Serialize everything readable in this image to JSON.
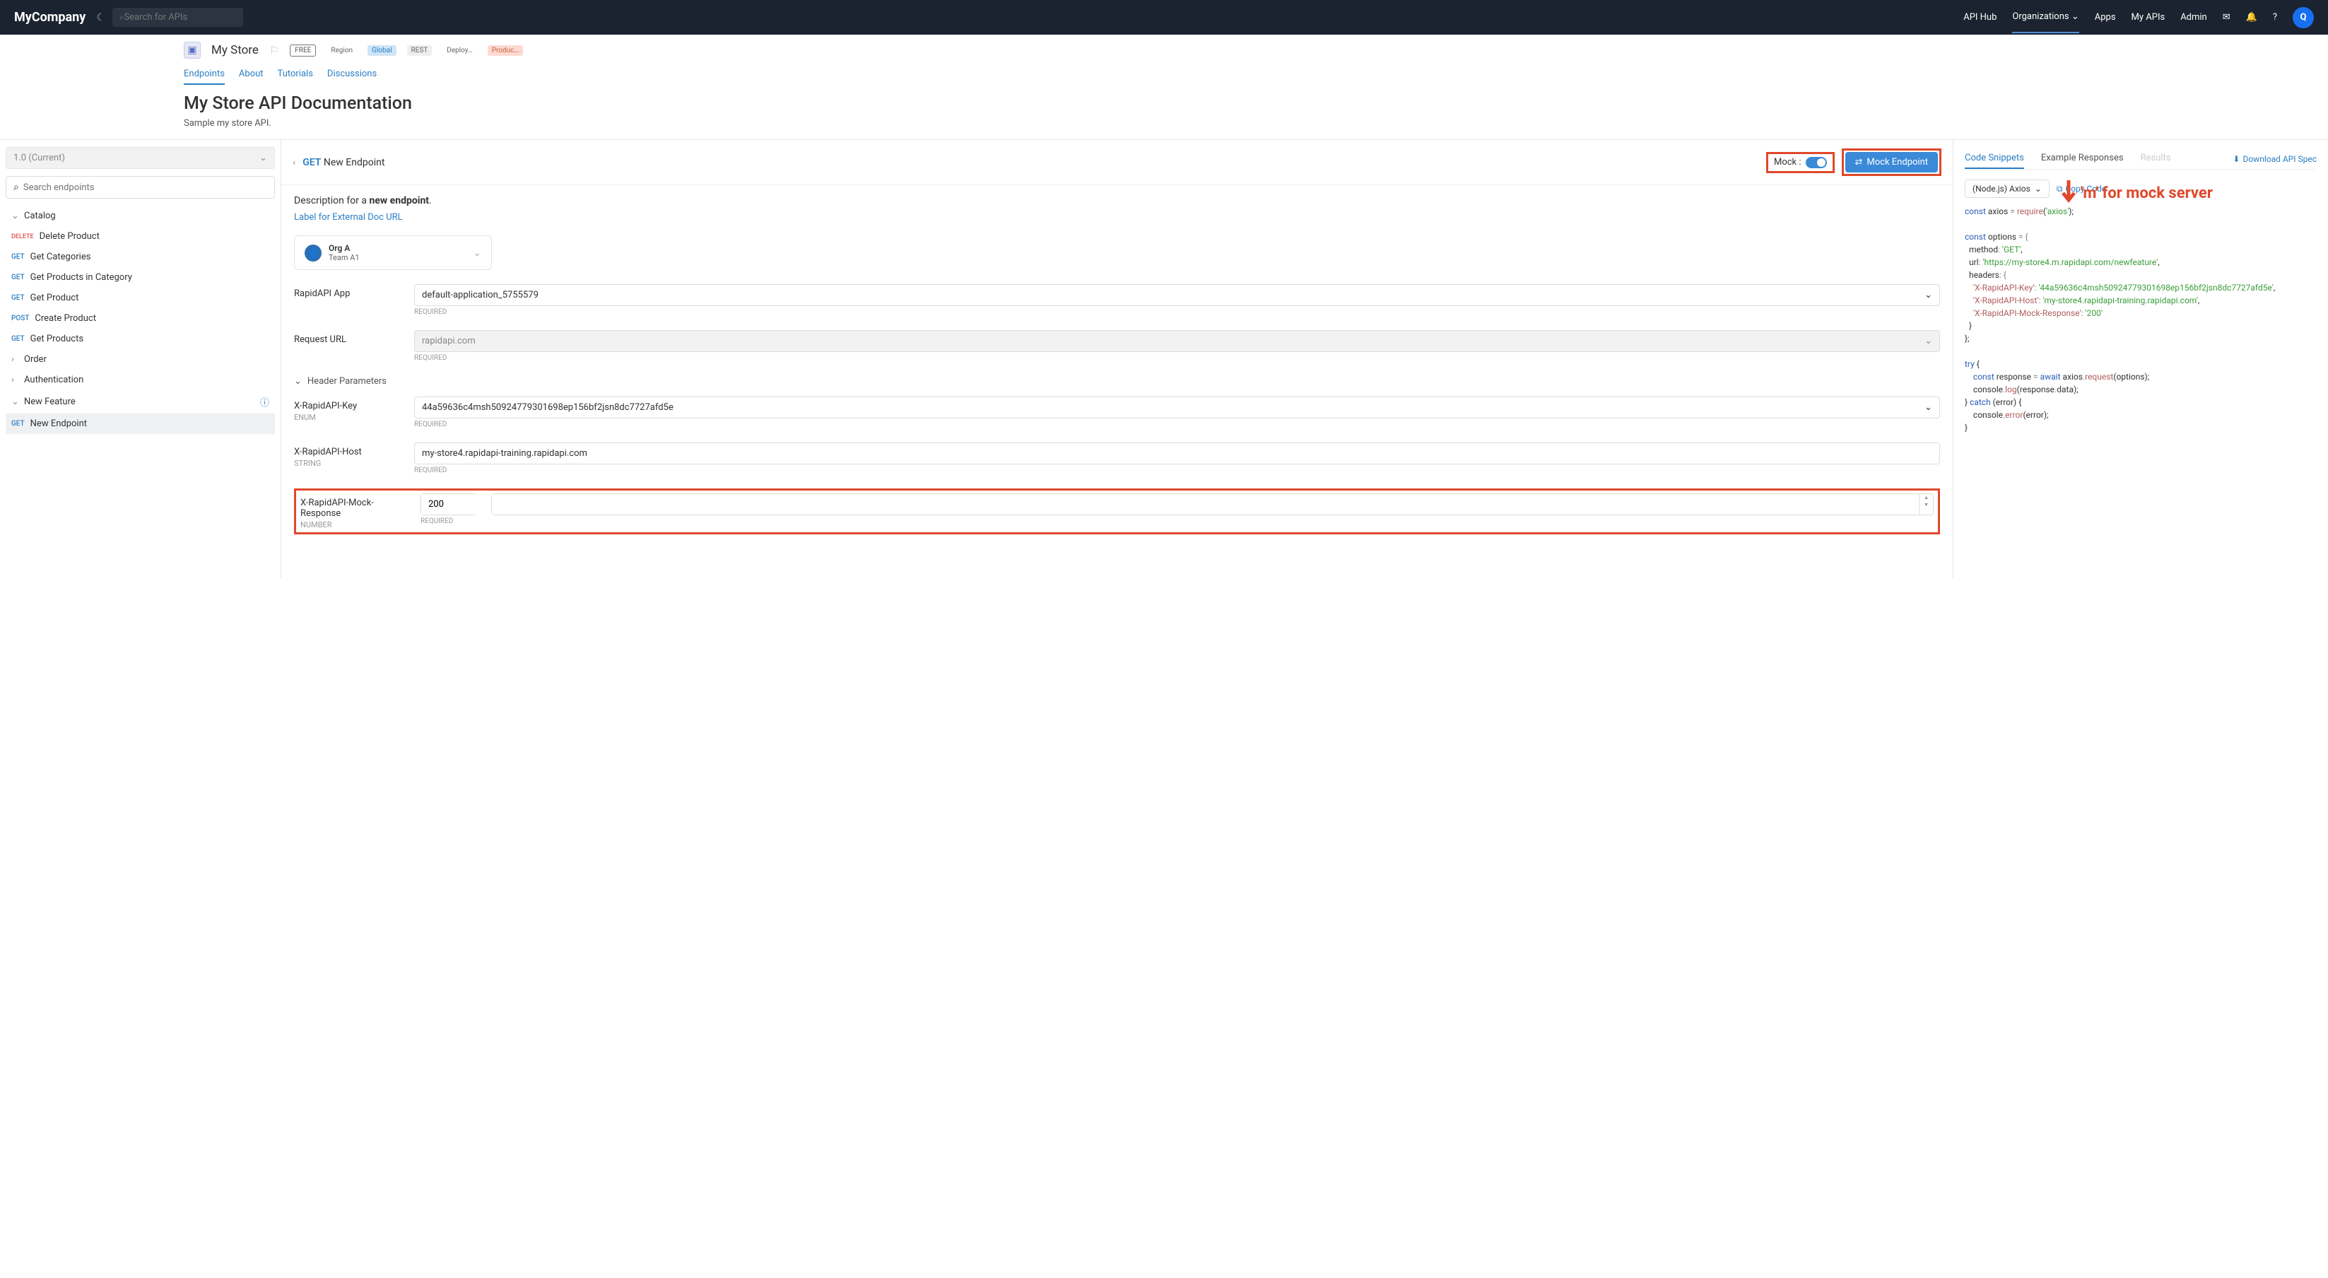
{
  "header": {
    "brand": "MyCompany",
    "searchPlaceholder": "Search for APIs",
    "nav": [
      "API Hub",
      "Organizations",
      "Apps",
      "My APIs",
      "Admin"
    ]
  },
  "sub": {
    "apiName": "My Store",
    "badges": {
      "free": "FREE",
      "region": "Region",
      "global": "Global",
      "rest": "REST",
      "deploy": "Deploy…",
      "prod": "Produc…"
    },
    "tabs": [
      "Endpoints",
      "About",
      "Tutorials",
      "Discussions"
    ],
    "docTitle": "My Store API Documentation",
    "docDesc": "Sample my store API."
  },
  "sidebar": {
    "version": "1.0 (Current)",
    "searchPlaceholder": "Search endpoints",
    "groups": [
      {
        "name": "Catalog",
        "open": true,
        "items": [
          {
            "method": "DELETE",
            "label": "Delete Product"
          },
          {
            "method": "GET",
            "label": "Get Categories"
          },
          {
            "method": "GET",
            "label": "Get Products in Category"
          },
          {
            "method": "GET",
            "label": "Get Product"
          },
          {
            "method": "POST",
            "label": "Create Product"
          },
          {
            "method": "GET",
            "label": "Get Products"
          }
        ]
      },
      {
        "name": "Order",
        "open": false,
        "items": []
      },
      {
        "name": "Authentication",
        "open": false,
        "items": []
      },
      {
        "name": "New Feature",
        "open": true,
        "info": true,
        "items": [
          {
            "method": "GET",
            "label": "New Endpoint",
            "active": true
          }
        ]
      }
    ]
  },
  "center": {
    "method": "GET",
    "name": "New Endpoint",
    "mockLabel": "Mock :",
    "mockBtn": "Mock Endpoint",
    "descPrefix": "Description for a ",
    "descBold": "new endpoint",
    "descSuffix": ".",
    "extLink": "Label for External Doc URL",
    "org": {
      "name": "Org A",
      "team": "Team A1"
    },
    "fields": {
      "appLabel": "RapidAPI App",
      "appValue": "default-application_5755579",
      "urlLabel": "Request URL",
      "urlValue": "rapidapi.com",
      "headersTitle": "Header Parameters",
      "keyLabel": "X-RapidAPI-Key",
      "keyType": "ENUM",
      "keyValue": "44a59636c4msh50924779301698ep156bf2jsn8dc7727afd5e",
      "hostLabel": "X-RapidAPI-Host",
      "hostType": "STRING",
      "hostValue": "my-store4.rapidapi-training.rapidapi.com",
      "mockLabel": "X-RapidAPI-Mock-Response",
      "mockType": "NUMBER",
      "mockValue": "200",
      "required": "REQUIRED"
    }
  },
  "right": {
    "tabs": [
      "Code Snippets",
      "Example Responses",
      "Results"
    ],
    "download": "Download API Spec",
    "lang": "(Node.js) Axios",
    "copy": "Copy Code",
    "annotation": "'m' for mock server",
    "code": {
      "l1a": "const ",
      "l1b": "axios",
      "l1c": " = ",
      "l1d": "require",
      "l1e": "(",
      "l1f": "'axios'",
      "l1g": ");",
      "l3a": "const ",
      "l3b": "options",
      "l3c": " = {",
      "l4a": "  method",
      "l4b": ": ",
      "l4c": "'GET'",
      "l4d": ",",
      "l5a": "  url",
      "l5b": ": ",
      "l5c": "'https://my-store4.m.rapidapi.com/newfeature'",
      "l5d": ",",
      "l6a": "  headers",
      "l6b": ": {",
      "l7a": "    'X-RapidAPI-Key'",
      "l7b": ": ",
      "l7c": "'44a59636c4msh50924779301698ep156bf2jsn8dc7727afd5e'",
      "l7d": ",",
      "l8a": "    'X-RapidAPI-Host'",
      "l8b": ": ",
      "l8c": "'my-store4.rapidapi-training.rapidapi.com'",
      "l8d": ",",
      "l9a": "    'X-RapidAPI-Mock-Response'",
      "l9b": ": ",
      "l9c": "'200'",
      "l10": "  }",
      "l11": "};",
      "l13a": "try ",
      "l13b": "{",
      "l14a": "    const ",
      "l14b": "response",
      "l14c": " = ",
      "l14d": "await ",
      "l14e": "axios",
      "l14f": ".",
      "l14g": "request",
      "l14h": "(options);",
      "l15a": "    console",
      "l15b": ".",
      "l15c": "log",
      "l15d": "(response",
      "l15e": ".",
      "l15f": "data",
      "l15g": ");",
      "l16a": "} ",
      "l16b": "catch ",
      "l16c": "(error) {",
      "l17a": "    console",
      "l17b": ".",
      "l17c": "error",
      "l17d": "(error);",
      "l18": "}"
    }
  }
}
